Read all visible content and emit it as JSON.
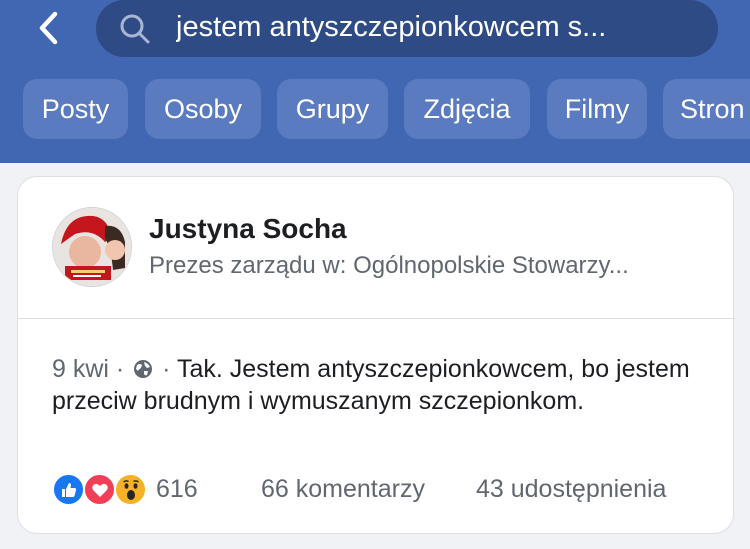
{
  "search": {
    "query": "jestem antyszczepionkowcem s..."
  },
  "tabs": [
    {
      "label": "Posty"
    },
    {
      "label": "Osoby"
    },
    {
      "label": "Grupy"
    },
    {
      "label": "Zdjęcia"
    },
    {
      "label": "Filmy"
    },
    {
      "label": "Stron"
    }
  ],
  "post": {
    "author": "Justyna Socha",
    "author_subtitle": "Prezes zarządu w: Ogólnopolskie Stowarzy...",
    "date": "9 kwi",
    "separator": "·",
    "text": "Tak. Jestem antyszczepionkowcem, bo jestem przeciw brudnym i wymuszanym szczepionkom.",
    "reactions": {
      "icons": [
        "like-icon",
        "love-icon",
        "wow-icon"
      ],
      "count": "616"
    },
    "comments": "66 komentarzy",
    "shares": "43 udostępnienia"
  },
  "colors": {
    "header": "#4267b2",
    "search_bg": "#2f4b86",
    "tab_bg": "#5a7bc0",
    "like": "#1877f2",
    "love": "#f33e58",
    "wow": "#f7b125"
  }
}
